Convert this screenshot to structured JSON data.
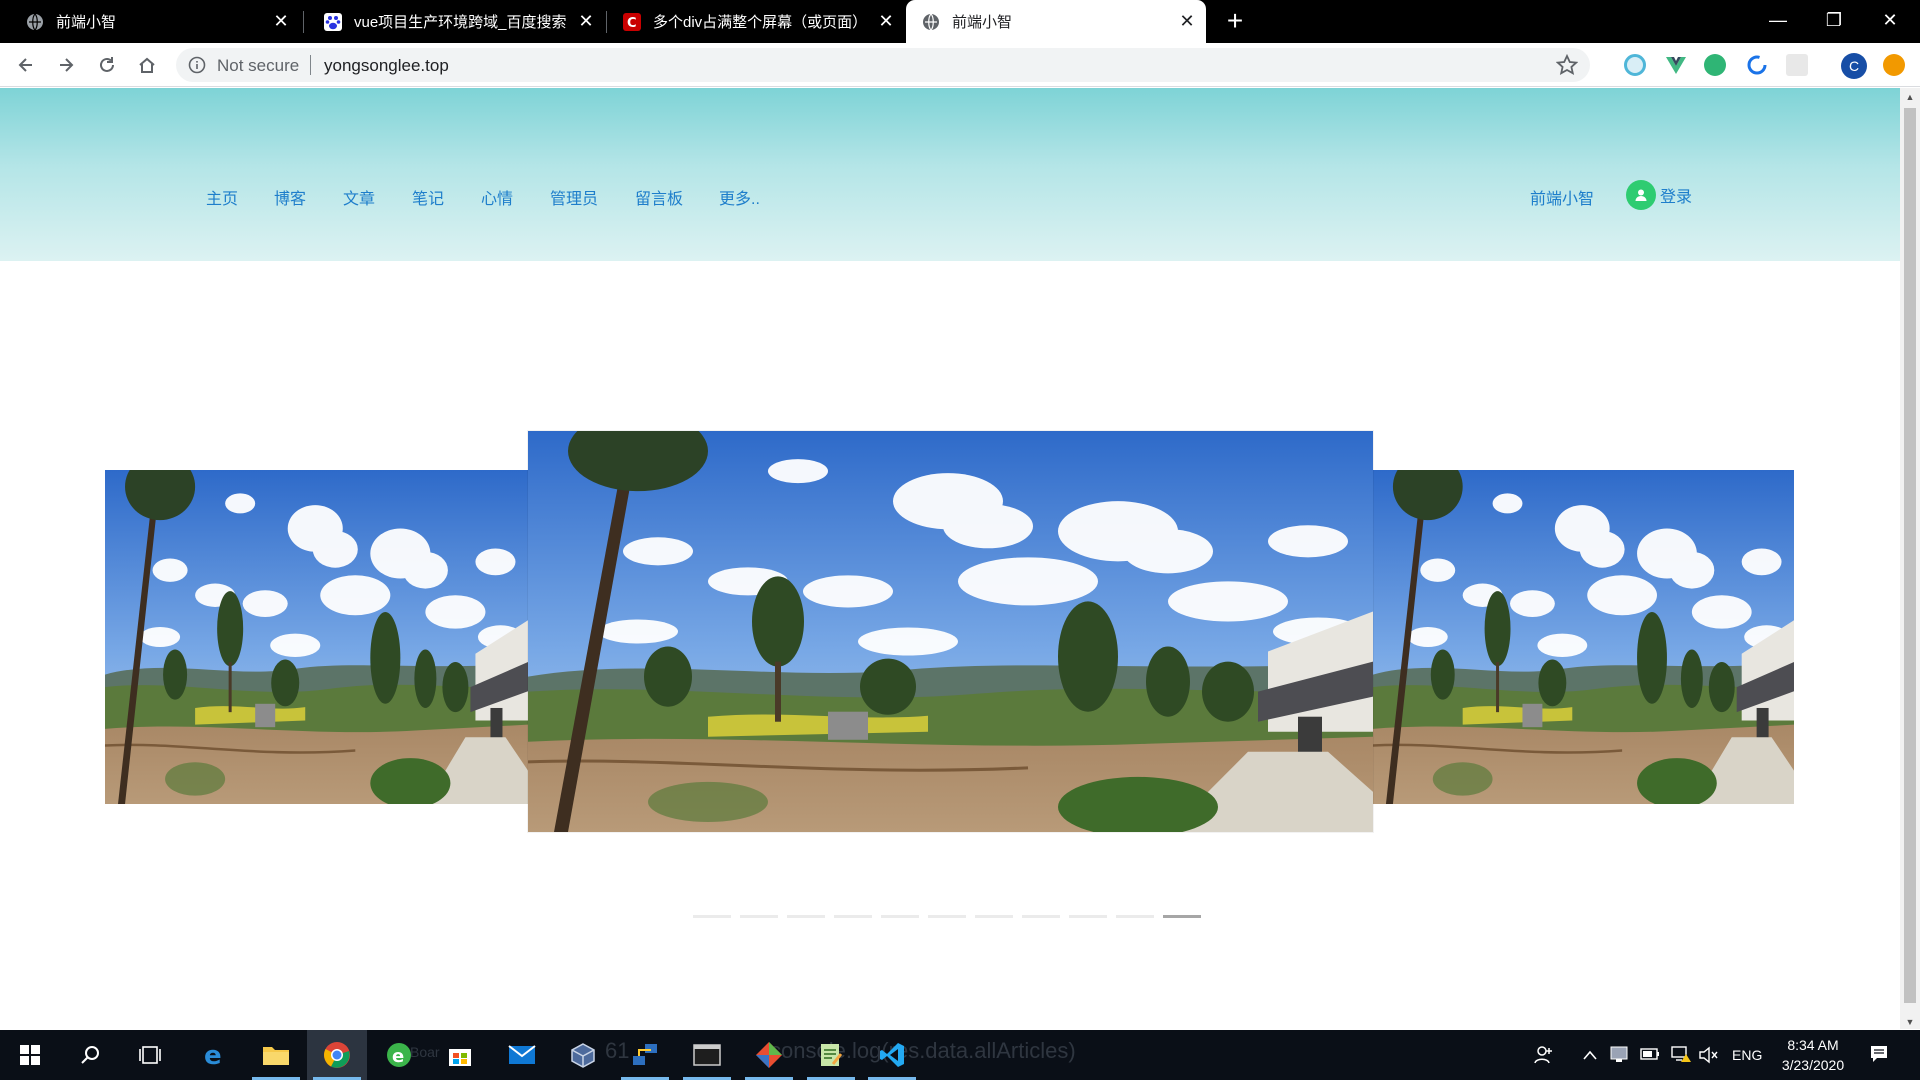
{
  "browser": {
    "tabs": [
      {
        "title": "前端小智",
        "favicon": "globe-icon",
        "active": false
      },
      {
        "title": "vue项目生产环境跨域_百度搜索",
        "favicon": "baidu-paw-icon",
        "active": false
      },
      {
        "title": "多个div占满整个屏幕（或页面）",
        "favicon": "csdn-icon",
        "active": false
      },
      {
        "title": "前端小智",
        "favicon": "globe-icon",
        "active": true
      }
    ],
    "address": {
      "security_label": "Not secure",
      "url": "yongsonglee.top"
    },
    "profile_initial": "C"
  },
  "site": {
    "nav": [
      "主页",
      "博客",
      "文章",
      "笔记",
      "心情",
      "管理员",
      "留言板",
      "更多.."
    ],
    "brand": "前端小智",
    "login_label": "登录",
    "colors": {
      "link": "#1e7ecb",
      "header_top": "#7ed3d6",
      "header_bottom": "#dcf2f2",
      "login_badge": "#2ecc71"
    }
  },
  "carousel": {
    "slides": [
      "landscape-photo",
      "landscape-photo",
      "landscape-photo"
    ],
    "indicator_count": 11,
    "active_indicator": 10
  },
  "taskbar": {
    "ghost_texts": [
      "61",
      "console.log(res.data.allArticles)",
      "Boar"
    ],
    "language": "ENG",
    "time": "8:34 AM",
    "date": "3/23/2020"
  }
}
